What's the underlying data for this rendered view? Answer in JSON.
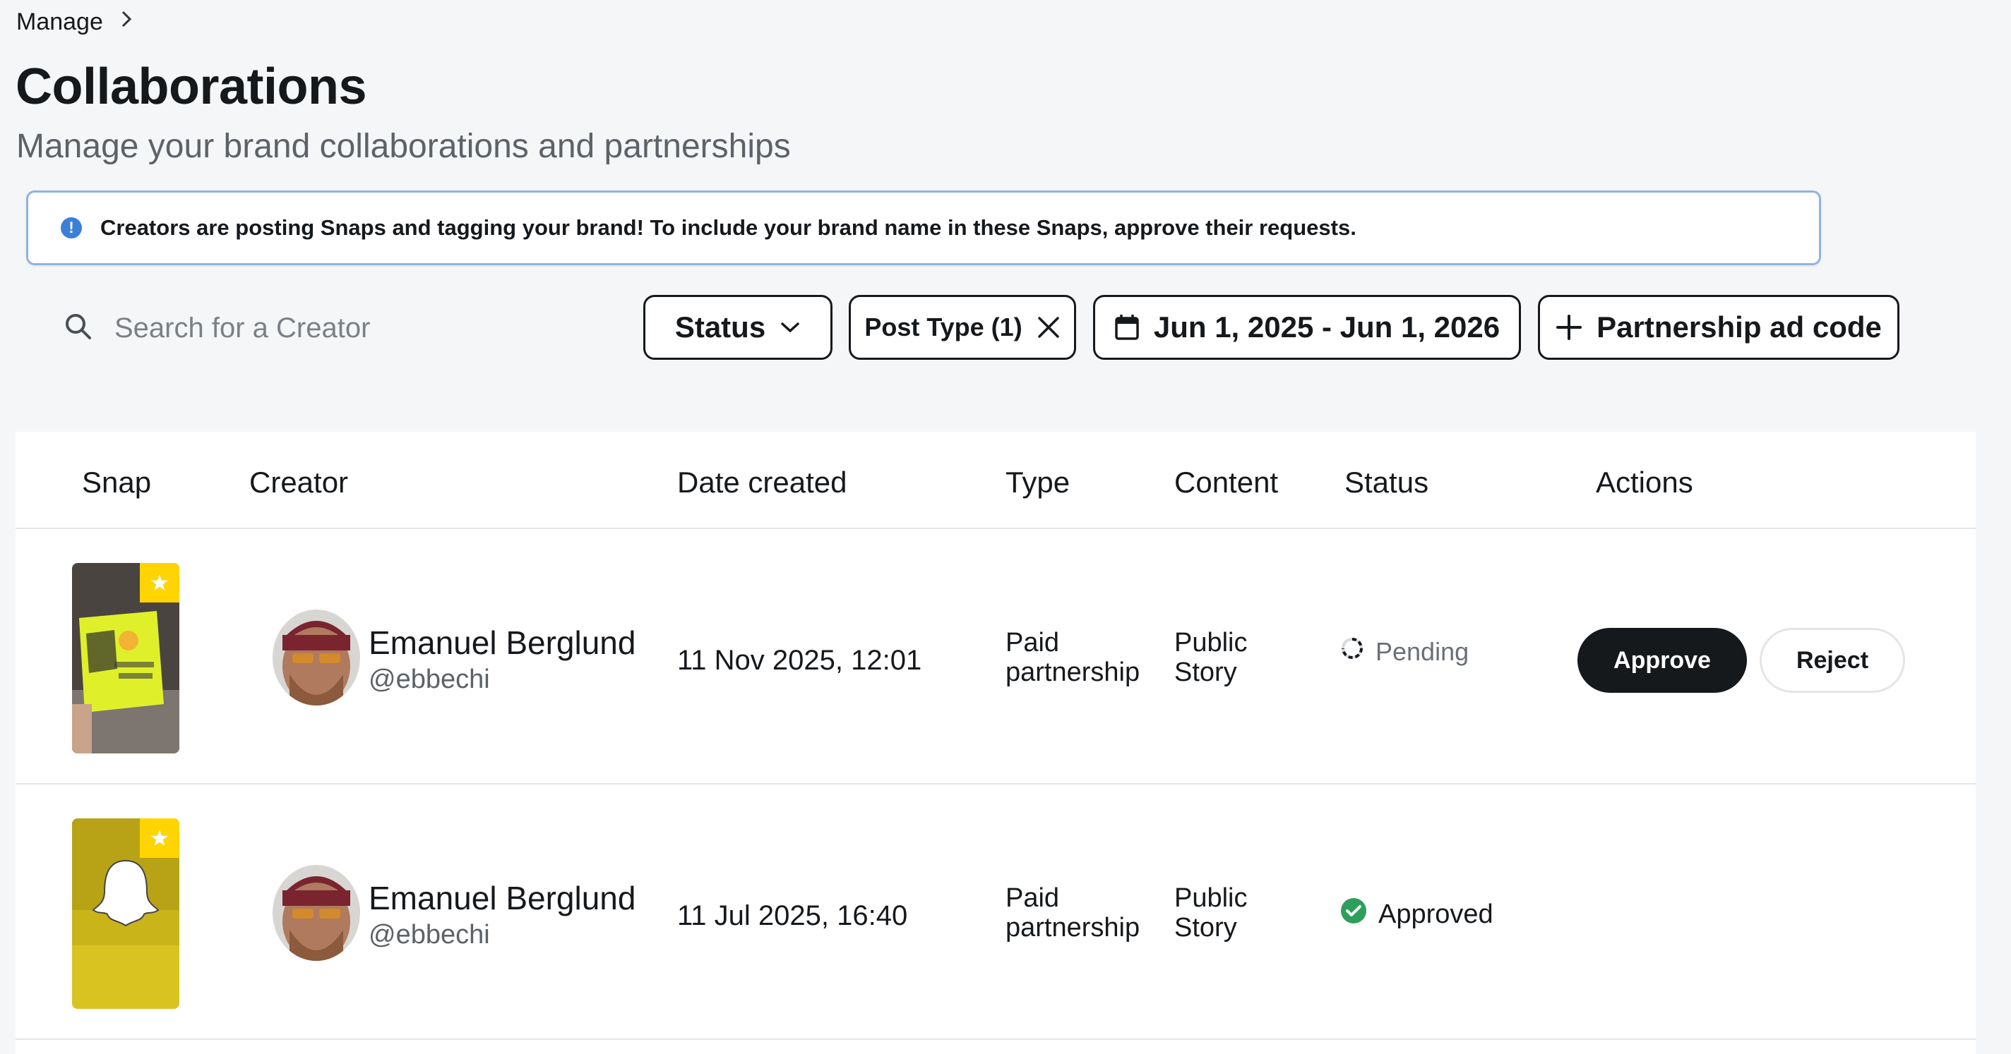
{
  "breadcrumb": {
    "root": "Manage"
  },
  "header": {
    "title": "Collaborations",
    "subtitle": "Manage your brand collaborations and partnerships"
  },
  "banner": {
    "text": "Creators are posting Snaps and tagging your brand! To include your brand name in these Snaps, approve their requests."
  },
  "toolbar": {
    "search_placeholder": "Search for a Creator",
    "status_label": "Status",
    "post_type_label": "Post Type (1)",
    "date_range_label": "Jun 1, 2025 - Jun 1, 2026",
    "partner_code_label": "Partnership ad code"
  },
  "table": {
    "columns": [
      "Snap",
      "Creator",
      "Date created",
      "Type",
      "Content",
      "Status",
      "Actions"
    ],
    "rows": [
      {
        "creator_name": "Emanuel Berglund",
        "creator_handle": "@ebbechi",
        "date": "11 Nov 2025, 12:01",
        "type_line1": "Paid",
        "type_line2": "partnership",
        "content_line1": "Public",
        "content_line2": "Story",
        "status": "Pending",
        "approve_label": "Approve",
        "reject_label": "Reject"
      },
      {
        "creator_name": "Emanuel Berglund",
        "creator_handle": "@ebbechi",
        "date": "11 Jul 2025, 16:40",
        "type_line1": "Paid",
        "type_line2": "partnership",
        "content_line1": "Public",
        "content_line2": "Story",
        "status": "Approved"
      }
    ]
  },
  "colors": {
    "accent_snap_yellow": "#ffd400",
    "approved_green": "#2e9e5b",
    "banner_info_blue": "#3b7fd9",
    "primary_button": "#16191c"
  }
}
